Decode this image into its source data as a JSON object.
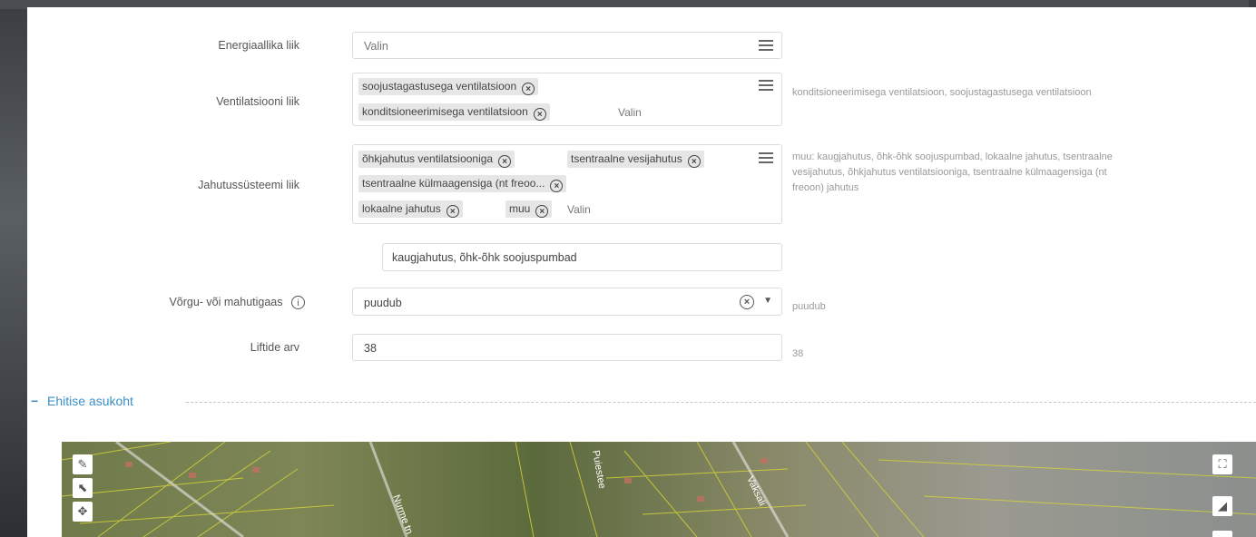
{
  "fields": {
    "energy_source": {
      "label": "Energiaallika liik",
      "value": "Valin"
    },
    "ventilation": {
      "label": "Ventilatsiooni liik",
      "tags": [
        "soojustagastusega ventilatsioon",
        "konditsioneerimisega ventilatsioon"
      ],
      "placeholder": "Valin",
      "hint": "konditsioneerimisega ventilatsioon, soojustagastusega ventilatsioon"
    },
    "cooling": {
      "label": "Jahutussüsteemi liik",
      "tags": [
        "õhkjahutus ventilatsiooniga",
        "tsentraalne vesijahutus",
        "tsentraalne külmaagensiga (nt freoo...",
        "lokaalne jahutus",
        "muu"
      ],
      "placeholder": "Valin",
      "hint": "muu: kaugjahutus, õhk-õhk soojuspumbad, lokaalne jahutus, tsentraalne vesijahutus, õhkjahutus ventilatsiooniga, tsentraalne külmaagensiga (nt freoon) jahutus",
      "other_value": "kaugjahutus, õhk-õhk soojuspumbad"
    },
    "gas": {
      "label": "Võrgu- või mahutigaas",
      "value": "puudub",
      "hint": "puudub"
    },
    "elevators": {
      "label": "Liftide arv",
      "value": "38",
      "hint": "38"
    }
  },
  "section": {
    "title": "Ehitise asukoht",
    "toggle": "−"
  },
  "map": {
    "street_labels": [
      "Nurme tn",
      "Puiestee",
      "Vaksali"
    ],
    "tools_left": [
      "draw-line-icon",
      "select-icon",
      "pan-icon"
    ],
    "tools_right": [
      "fullscreen-icon",
      "measure-icon",
      "layers-icon"
    ]
  },
  "colors": {
    "accent": "#3a8fc9",
    "tag_bg": "#e6e6e6"
  }
}
